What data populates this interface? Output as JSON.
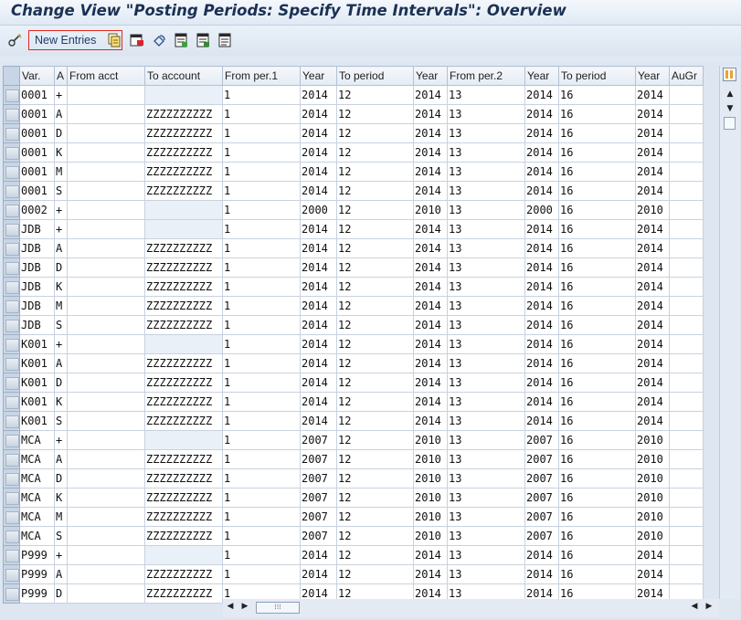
{
  "title": "Change View \"Posting Periods: Specify Time Intervals\": Overview",
  "toolbar": {
    "new_entries": "New Entries",
    "icons": [
      "edit-glasses-icon",
      "copy-icon",
      "delete-icon",
      "undo-icon",
      "select-all-icon",
      "select-block-icon",
      "deselect-all-icon"
    ]
  },
  "table": {
    "columns": [
      "Var.",
      "A",
      "From acct",
      "To account",
      "From per.1",
      "Year",
      "To period",
      "Year",
      "From per.2",
      "Year",
      "To period",
      "Year",
      "AuGr"
    ],
    "rows": [
      [
        "0001",
        "+",
        "",
        "",
        "1",
        "2014",
        "12",
        "2014",
        "13",
        "2014",
        "16",
        "2014",
        ""
      ],
      [
        "0001",
        "A",
        "",
        "ZZZZZZZZZZ",
        "1",
        "2014",
        "12",
        "2014",
        "13",
        "2014",
        "16",
        "2014",
        ""
      ],
      [
        "0001",
        "D",
        "",
        "ZZZZZZZZZZ",
        "1",
        "2014",
        "12",
        "2014",
        "13",
        "2014",
        "16",
        "2014",
        ""
      ],
      [
        "0001",
        "K",
        "",
        "ZZZZZZZZZZ",
        "1",
        "2014",
        "12",
        "2014",
        "13",
        "2014",
        "16",
        "2014",
        ""
      ],
      [
        "0001",
        "M",
        "",
        "ZZZZZZZZZZ",
        "1",
        "2014",
        "12",
        "2014",
        "13",
        "2014",
        "16",
        "2014",
        ""
      ],
      [
        "0001",
        "S",
        "",
        "ZZZZZZZZZZ",
        "1",
        "2014",
        "12",
        "2014",
        "13",
        "2014",
        "16",
        "2014",
        ""
      ],
      [
        "0002",
        "+",
        "",
        "",
        "1",
        "2000",
        "12",
        "2010",
        "13",
        "2000",
        "16",
        "2010",
        ""
      ],
      [
        "JDB",
        "+",
        "",
        "",
        "1",
        "2014",
        "12",
        "2014",
        "13",
        "2014",
        "16",
        "2014",
        ""
      ],
      [
        "JDB",
        "A",
        "",
        "ZZZZZZZZZZ",
        "1",
        "2014",
        "12",
        "2014",
        "13",
        "2014",
        "16",
        "2014",
        ""
      ],
      [
        "JDB",
        "D",
        "",
        "ZZZZZZZZZZ",
        "1",
        "2014",
        "12",
        "2014",
        "13",
        "2014",
        "16",
        "2014",
        ""
      ],
      [
        "JDB",
        "K",
        "",
        "ZZZZZZZZZZ",
        "1",
        "2014",
        "12",
        "2014",
        "13",
        "2014",
        "16",
        "2014",
        ""
      ],
      [
        "JDB",
        "M",
        "",
        "ZZZZZZZZZZ",
        "1",
        "2014",
        "12",
        "2014",
        "13",
        "2014",
        "16",
        "2014",
        ""
      ],
      [
        "JDB",
        "S",
        "",
        "ZZZZZZZZZZ",
        "1",
        "2014",
        "12",
        "2014",
        "13",
        "2014",
        "16",
        "2014",
        ""
      ],
      [
        "K001",
        "+",
        "",
        "",
        "1",
        "2014",
        "12",
        "2014",
        "13",
        "2014",
        "16",
        "2014",
        ""
      ],
      [
        "K001",
        "A",
        "",
        "ZZZZZZZZZZ",
        "1",
        "2014",
        "12",
        "2014",
        "13",
        "2014",
        "16",
        "2014",
        ""
      ],
      [
        "K001",
        "D",
        "",
        "ZZZZZZZZZZ",
        "1",
        "2014",
        "12",
        "2014",
        "13",
        "2014",
        "16",
        "2014",
        ""
      ],
      [
        "K001",
        "K",
        "",
        "ZZZZZZZZZZ",
        "1",
        "2014",
        "12",
        "2014",
        "13",
        "2014",
        "16",
        "2014",
        ""
      ],
      [
        "K001",
        "S",
        "",
        "ZZZZZZZZZZ",
        "1",
        "2014",
        "12",
        "2014",
        "13",
        "2014",
        "16",
        "2014",
        ""
      ],
      [
        "MCA",
        "+",
        "",
        "",
        "1",
        "2007",
        "12",
        "2010",
        "13",
        "2007",
        "16",
        "2010",
        ""
      ],
      [
        "MCA",
        "A",
        "",
        "ZZZZZZZZZZ",
        "1",
        "2007",
        "12",
        "2010",
        "13",
        "2007",
        "16",
        "2010",
        ""
      ],
      [
        "MCA",
        "D",
        "",
        "ZZZZZZZZZZ",
        "1",
        "2007",
        "12",
        "2010",
        "13",
        "2007",
        "16",
        "2010",
        ""
      ],
      [
        "MCA",
        "K",
        "",
        "ZZZZZZZZZZ",
        "1",
        "2007",
        "12",
        "2010",
        "13",
        "2007",
        "16",
        "2010",
        ""
      ],
      [
        "MCA",
        "M",
        "",
        "ZZZZZZZZZZ",
        "1",
        "2007",
        "12",
        "2010",
        "13",
        "2007",
        "16",
        "2010",
        ""
      ],
      [
        "MCA",
        "S",
        "",
        "ZZZZZZZZZZ",
        "1",
        "2007",
        "12",
        "2010",
        "13",
        "2007",
        "16",
        "2010",
        ""
      ],
      [
        "P999",
        "+",
        "",
        "",
        "1",
        "2014",
        "12",
        "2014",
        "13",
        "2014",
        "16",
        "2014",
        ""
      ],
      [
        "P999",
        "A",
        "",
        "ZZZZZZZZZZ",
        "1",
        "2014",
        "12",
        "2014",
        "13",
        "2014",
        "16",
        "2014",
        ""
      ],
      [
        "P999",
        "D",
        "",
        "ZZZZZZZZZZ",
        "1",
        "2014",
        "12",
        "2014",
        "13",
        "2014",
        "16",
        "2014",
        ""
      ]
    ]
  }
}
